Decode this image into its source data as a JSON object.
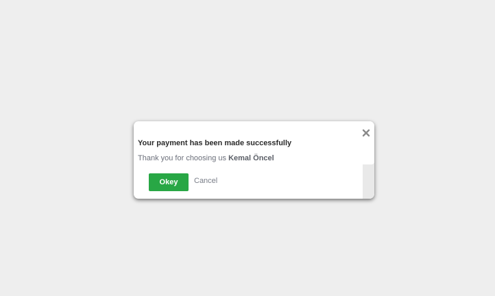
{
  "dialog": {
    "title": "Your payment has been made successfully",
    "message_prefix": "Thank you for choosing us ",
    "message_name": "Kemal Öncel",
    "close_icon": "close-icon",
    "okey_label": "Okey",
    "cancel_label": "Cancel"
  },
  "colors": {
    "background": "#eeeeee",
    "dialog": "#ffffff",
    "okey_button": "#28a745",
    "close_icon": "#8a8a8a"
  }
}
